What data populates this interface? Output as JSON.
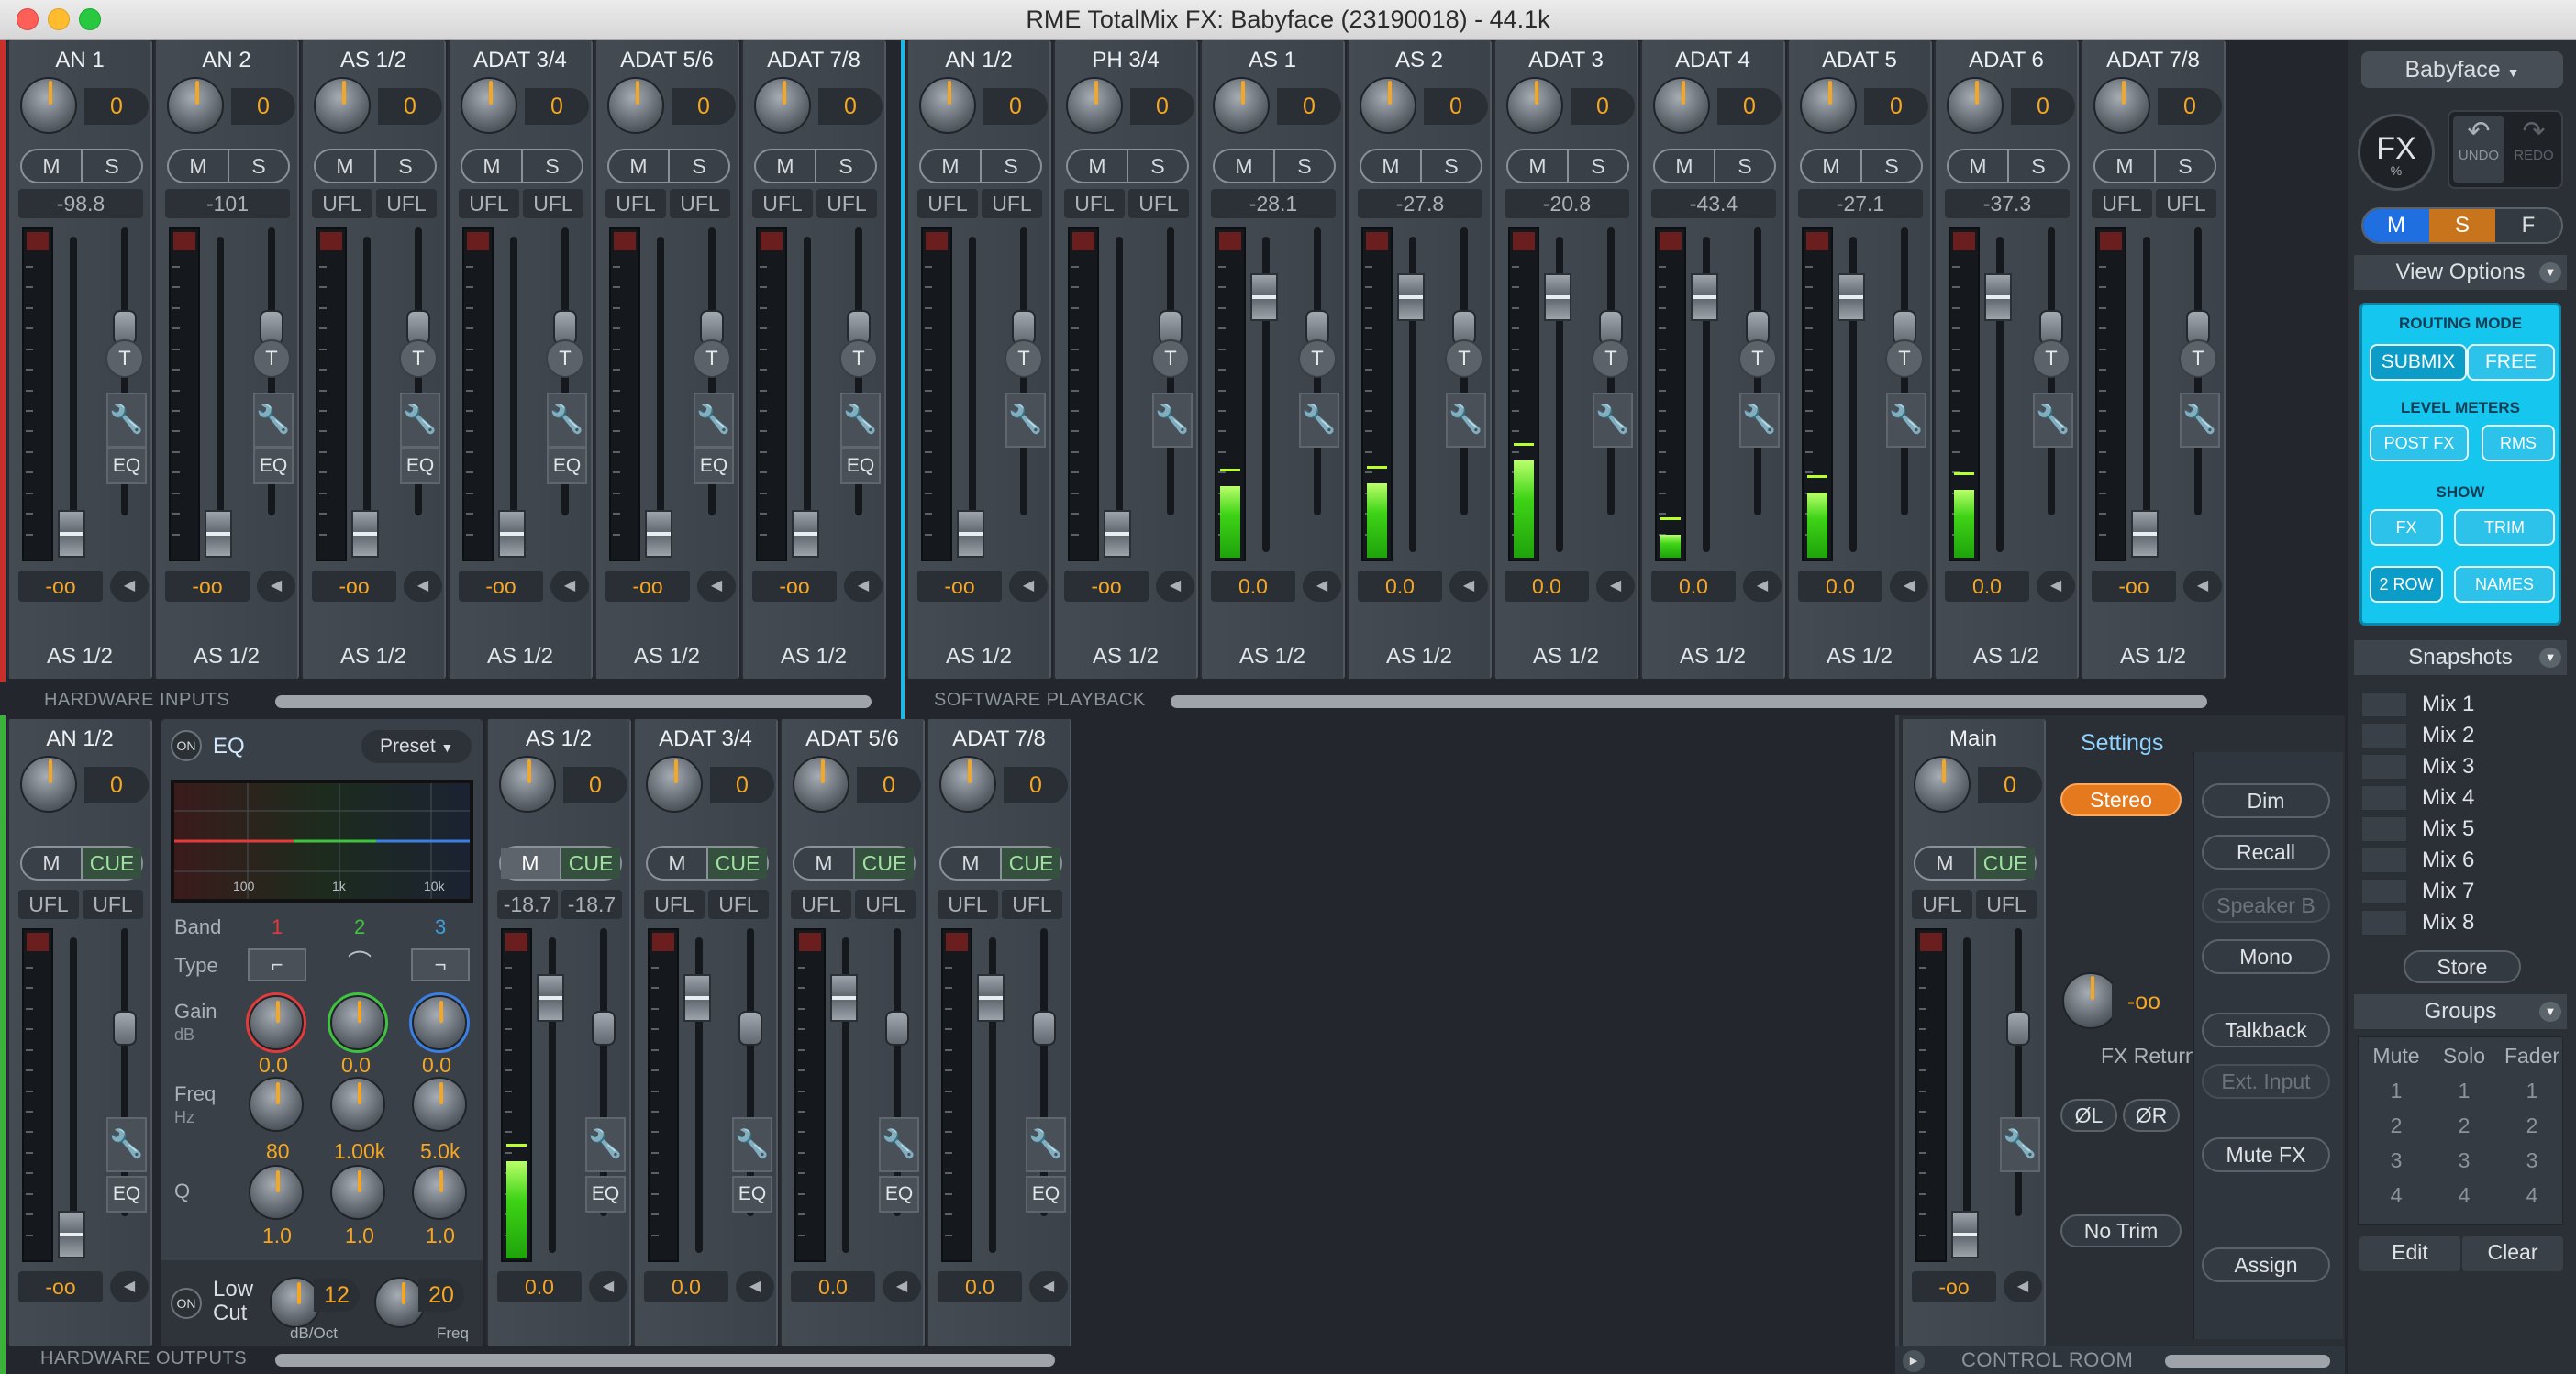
{
  "window": {
    "title": "RME TotalMix FX: Babyface (23190018) - 44.1k"
  },
  "hardware_inputs": {
    "label": "HARDWARE INPUTS",
    "channels": [
      {
        "name": "AN 1",
        "gain": "0",
        "level_l": "-98.8",
        "level_r": "",
        "volume": "-oo",
        "route": "AS 1/2",
        "meter": 0
      },
      {
        "name": "AN 2",
        "gain": "0",
        "level_l": "-101",
        "level_r": "",
        "volume": "-oo",
        "route": "AS 1/2",
        "meter": 0
      },
      {
        "name": "AS 1/2",
        "gain": "0",
        "level_l": "UFL",
        "level_r": "UFL",
        "volume": "-oo",
        "route": "AS 1/2",
        "meter": 0
      },
      {
        "name": "ADAT 3/4",
        "gain": "0",
        "level_l": "UFL",
        "level_r": "UFL",
        "volume": "-oo",
        "route": "AS 1/2",
        "meter": 0
      },
      {
        "name": "ADAT 5/6",
        "gain": "0",
        "level_l": "UFL",
        "level_r": "UFL",
        "volume": "-oo",
        "route": "AS 1/2",
        "meter": 0
      },
      {
        "name": "ADAT 7/8",
        "gain": "0",
        "level_l": "UFL",
        "level_r": "UFL",
        "volume": "-oo",
        "route": "AS 1/2",
        "meter": 0
      }
    ]
  },
  "software_playback": {
    "label": "SOFTWARE PLAYBACK",
    "channels": [
      {
        "name": "AN 1/2",
        "gain": "0",
        "level_l": "UFL",
        "level_r": "UFL",
        "volume": "-oo",
        "route": "AS 1/2",
        "meter": 0
      },
      {
        "name": "PH 3/4",
        "gain": "0",
        "level_l": "UFL",
        "level_r": "UFL",
        "volume": "-oo",
        "route": "AS 1/2",
        "meter": 0
      },
      {
        "name": "AS 1",
        "gain": "0",
        "level_l": "-28.1",
        "level_r": "",
        "volume": "0.0",
        "route": "AS 1/2",
        "meter": 0.22
      },
      {
        "name": "AS 2",
        "gain": "0",
        "level_l": "-27.8",
        "level_r": "",
        "volume": "0.0",
        "route": "AS 1/2",
        "meter": 0.23
      },
      {
        "name": "ADAT 3",
        "gain": "0",
        "level_l": "-20.8",
        "level_r": "",
        "volume": "0.0",
        "route": "AS 1/2",
        "meter": 0.3
      },
      {
        "name": "ADAT 4",
        "gain": "0",
        "level_l": "-43.4",
        "level_r": "",
        "volume": "0.0",
        "route": "AS 1/2",
        "meter": 0.07
      },
      {
        "name": "ADAT 5",
        "gain": "0",
        "level_l": "-27.1",
        "level_r": "",
        "volume": "0.0",
        "route": "AS 1/2",
        "meter": 0.2
      },
      {
        "name": "ADAT 6",
        "gain": "0",
        "level_l": "-37.3",
        "level_r": "",
        "volume": "0.0",
        "route": "AS 1/2",
        "meter": 0.21
      },
      {
        "name": "ADAT 7/8",
        "gain": "0",
        "level_l": "UFL",
        "level_r": "UFL",
        "volume": "-oo",
        "route": "AS 1/2",
        "meter": 0
      }
    ]
  },
  "hardware_outputs": {
    "label": "HARDWARE OUTPUTS",
    "channels": [
      {
        "name": "AN 1/2",
        "gain": "0",
        "level_l": "UFL",
        "level_r": "UFL",
        "volume": "-oo",
        "meter": 0
      },
      {
        "name": "AS 1/2",
        "gain": "0",
        "level_l": "-18.7",
        "level_r": "-18.7",
        "volume": "0.0",
        "meter": 0.3
      },
      {
        "name": "ADAT 3/4",
        "gain": "0",
        "level_l": "UFL",
        "level_r": "UFL",
        "volume": "0.0",
        "meter": 0
      },
      {
        "name": "ADAT 5/6",
        "gain": "0",
        "level_l": "UFL",
        "level_r": "UFL",
        "volume": "0.0",
        "meter": 0
      },
      {
        "name": "ADAT 7/8",
        "gain": "0",
        "level_l": "UFL",
        "level_r": "UFL",
        "volume": "0.0",
        "meter": 0
      }
    ]
  },
  "buttons": {
    "mute": "M",
    "solo": "S",
    "cue": "CUE",
    "talkback": "T",
    "eq": "EQ"
  },
  "eq_panel": {
    "on": "ON",
    "title": "EQ",
    "preset": "Preset",
    "band_label": "Band",
    "bands": [
      "1",
      "2",
      "3"
    ],
    "band_colors": [
      "#e23b3b",
      "#3fc33f",
      "#3b7fe2"
    ],
    "type_label": "Type",
    "gain_label": "Gain",
    "gain_unit": "dB",
    "gains": [
      "0.0",
      "0.0",
      "0.0"
    ],
    "freq_label": "Freq",
    "freq_unit": "Hz",
    "freqs": [
      "80",
      "1.00k",
      "5.0k"
    ],
    "q_label": "Q",
    "qs": [
      "1.0",
      "1.0",
      "1.0"
    ],
    "graph_ticks": [
      "100",
      "1k",
      "10k"
    ],
    "lowcut_on": "ON",
    "lowcut_label_1": "Low",
    "lowcut_label_2": "Cut",
    "lowcut_slope": "12",
    "lowcut_slope_unit": "dB/Oct",
    "lowcut_freq": "20",
    "lowcut_freq_unit": "Freq"
  },
  "control_room": {
    "label": "CONTROL ROOM",
    "main": {
      "name": "Main",
      "gain": "0",
      "level_l": "UFL",
      "level_r": "UFL",
      "volume": "-oo"
    },
    "settings": "Settings",
    "stereo": "Stereo",
    "fx_return_value": "-oo",
    "fx_return": "FX Return",
    "phase_l": "ØL",
    "phase_r": "ØR",
    "no_trim": "No Trim",
    "side_buttons": [
      "Dim",
      "Recall",
      "Speaker B",
      "Mono",
      "Talkback",
      "Ext. Input",
      "Mute FX",
      "Assign"
    ]
  },
  "sidebar": {
    "device": "Babyface",
    "fx": "FX",
    "fx_sub": "%",
    "undo": "UNDO",
    "redo": "REDO",
    "msf": [
      "M",
      "S",
      "F"
    ],
    "view_options": "View Options",
    "routing_mode": "ROUTING MODE",
    "submix": "SUBMIX",
    "free": "FREE",
    "level_meters": "LEVEL METERS",
    "post_fx": "POST FX",
    "rms": "RMS",
    "show": "SHOW",
    "fx_btn": "FX",
    "trim": "TRIM",
    "two_row": "2 ROW",
    "names": "NAMES",
    "snapshots": "Snapshots",
    "mixes": [
      "Mix 1",
      "Mix 2",
      "Mix 3",
      "Mix 4",
      "Mix 5",
      "Mix 6",
      "Mix 7",
      "Mix 8"
    ],
    "store": "Store",
    "groups": "Groups",
    "group_cols": [
      "Mute",
      "Solo",
      "Fader"
    ],
    "group_nums": [
      "1",
      "2",
      "3",
      "4"
    ],
    "edit": "Edit",
    "clear": "Clear"
  },
  "colors": {
    "accent": "#f5a623",
    "cyan_panel": "#15c6ee",
    "meter_green": "#3ed316"
  }
}
